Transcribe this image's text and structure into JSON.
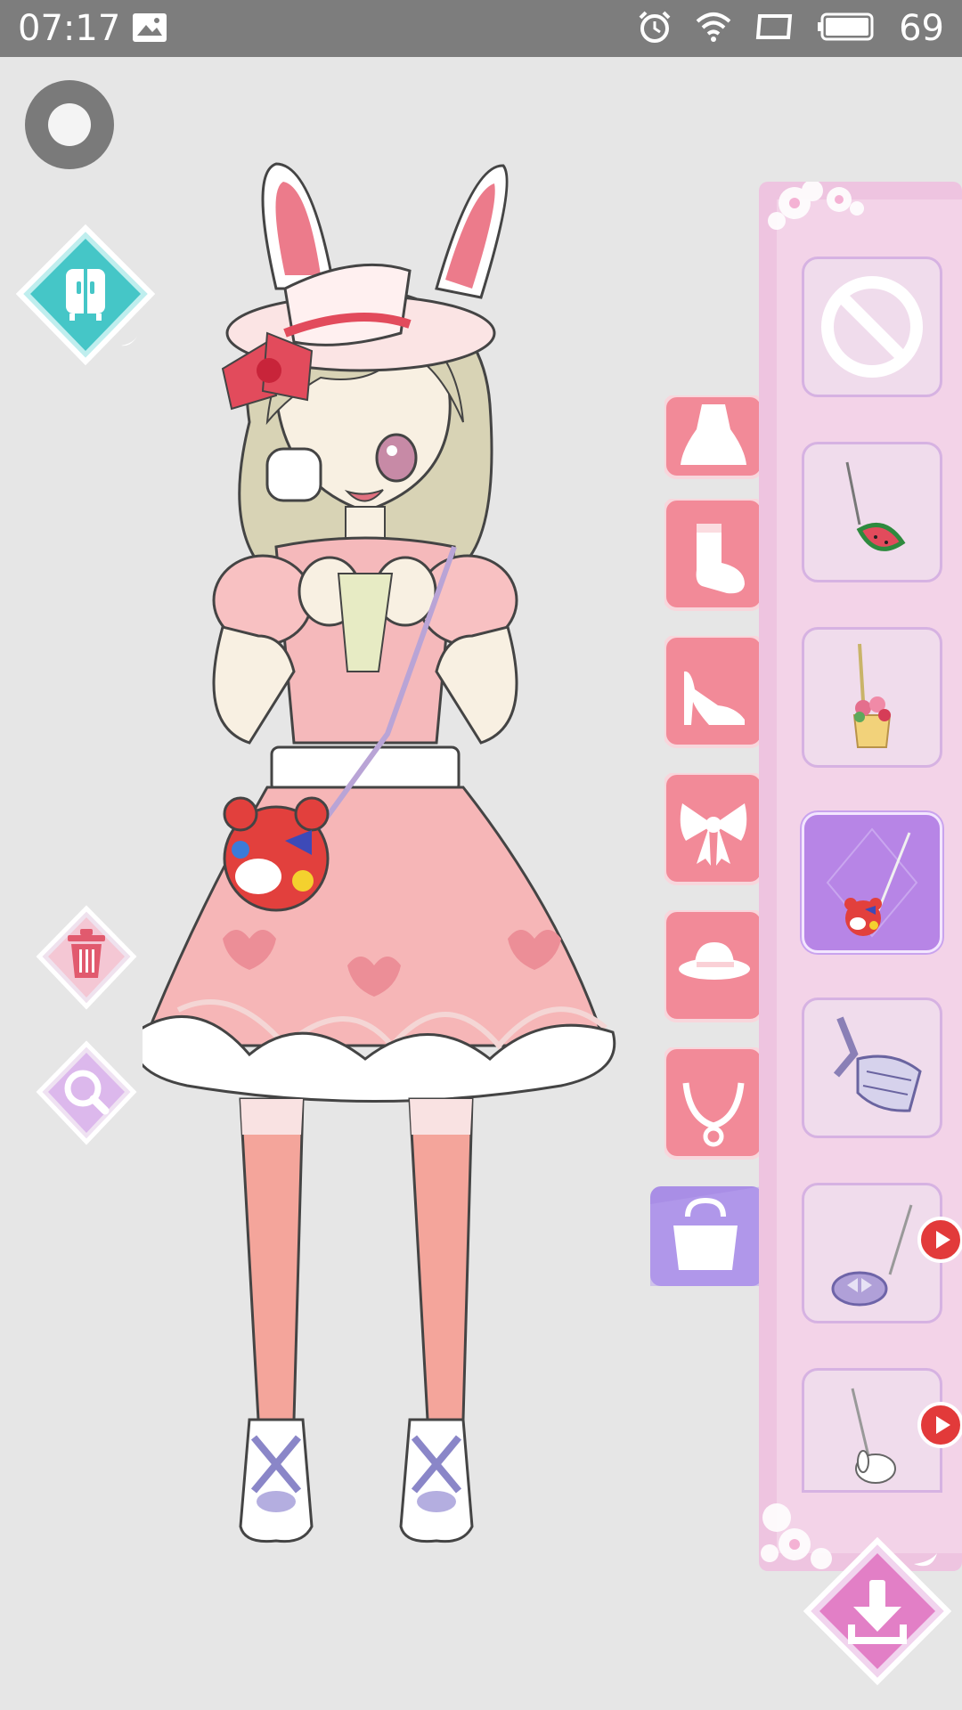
{
  "status_bar": {
    "time": "07:17",
    "battery": "69",
    "icons": [
      "image-icon",
      "alarm-icon",
      "wifi-icon",
      "screen-icon",
      "battery-icon"
    ]
  },
  "toolbar": {
    "record": "record-icon",
    "wardrobe": "wardrobe-icon",
    "delete": "trash-icon",
    "zoom": "magnifier-icon",
    "save": "download-icon"
  },
  "categories": [
    {
      "name": "dress",
      "icon": "dress-icon",
      "selected": false
    },
    {
      "name": "socks",
      "icon": "sock-icon",
      "selected": false
    },
    {
      "name": "shoes",
      "icon": "high-heel-icon",
      "selected": false
    },
    {
      "name": "bow",
      "icon": "bow-icon",
      "selected": false
    },
    {
      "name": "hat",
      "icon": "hat-icon",
      "selected": false
    },
    {
      "name": "necklace",
      "icon": "necklace-icon",
      "selected": false
    },
    {
      "name": "bag",
      "icon": "handbag-icon",
      "selected": true
    }
  ],
  "items": [
    {
      "id": "none",
      "icon": "none-icon",
      "selected": false,
      "ad": false
    },
    {
      "id": "watermelon-bag",
      "icon": "watermelon-bag-icon",
      "selected": false,
      "ad": false
    },
    {
      "id": "flower-basket-bag",
      "icon": "flower-basket-icon",
      "selected": false,
      "ad": false
    },
    {
      "id": "bear-bag",
      "icon": "bear-bag-icon",
      "selected": true,
      "ad": false
    },
    {
      "id": "checkered-waist-bag",
      "icon": "waist-bag-icon",
      "selected": false,
      "ad": false
    },
    {
      "id": "purple-round-bag",
      "icon": "round-bag-icon",
      "selected": false,
      "ad": true
    },
    {
      "id": "bunny-bag",
      "icon": "bunny-bag-icon",
      "selected": false,
      "ad": true
    }
  ],
  "colors": {
    "accent_pink": "#f28a98",
    "panel_pink": "#eec4e0",
    "selected_purple": "#b785e6",
    "teal": "#45c6c7",
    "ad_red": "#e23a3a"
  }
}
